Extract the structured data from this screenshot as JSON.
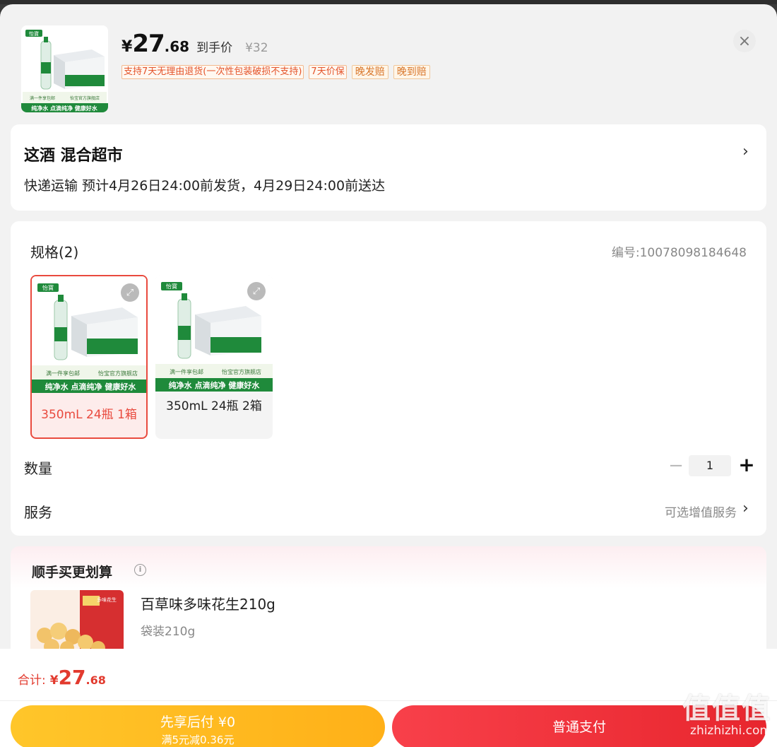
{
  "header": {
    "price_yen": "¥",
    "price_int": "27",
    "price_dec": ".68",
    "price_label": "到手价",
    "original_price": "¥32",
    "tags": [
      "支持7天无理由退货(一次性包装破损不支持)",
      "7天价保",
      "晚发赔",
      "晚到赔"
    ],
    "close": "×",
    "product_image": {
      "badge": "怡寶",
      "strip1_left": "满一件享包邮",
      "strip1_right": "怡宝官方旗舰店",
      "strip2": "纯净水 点滴纯净 健康好水"
    }
  },
  "shop": {
    "name": "这酒  混合超市",
    "delivery": "快递运输 预计4月26日24:00前发货，4月29日24:00前送达",
    "chevron": "›"
  },
  "spec": {
    "title": "规格(2)",
    "code": "编号:10078098184648",
    "options": [
      {
        "label": "350mL 24瓶 1箱",
        "selected": true
      },
      {
        "label": "350mL 24瓶 2箱",
        "selected": false
      }
    ],
    "sku_badge": "怡寶",
    "sku_strip1_left": "满一件享包邮",
    "sku_strip1_right": "怡宝官方旗舰店",
    "sku_strip2": "纯净水 点滴纯净 健康好水",
    "expand_icon": "⤢"
  },
  "quantity": {
    "label": "数量",
    "minus": "−",
    "value": "1",
    "plus": "+"
  },
  "service": {
    "label": "服务",
    "value": "可选增值服务",
    "chevron": "›"
  },
  "recommend": {
    "title": "顺手买更划算",
    "info": "i",
    "item_name": "百草味多味花生210g",
    "item_spec": "袋装210g",
    "img_text": "多味花生"
  },
  "footer": {
    "total_label": "合计:",
    "total_yen": "¥",
    "total_int": "27",
    "total_dec": ".68",
    "later_line1": "先享后付 ¥0",
    "later_line2": "满5元减0.36元",
    "pay_label": "普通支付"
  },
  "watermark": {
    "big": "值值值",
    "small": "zhizhizhi.com"
  },
  "colors": {
    "accent_red": "#e94a3e",
    "brand_green": "#1f8a3b",
    "later_yellow": "#ffb818",
    "pay_red": "#f03038"
  }
}
